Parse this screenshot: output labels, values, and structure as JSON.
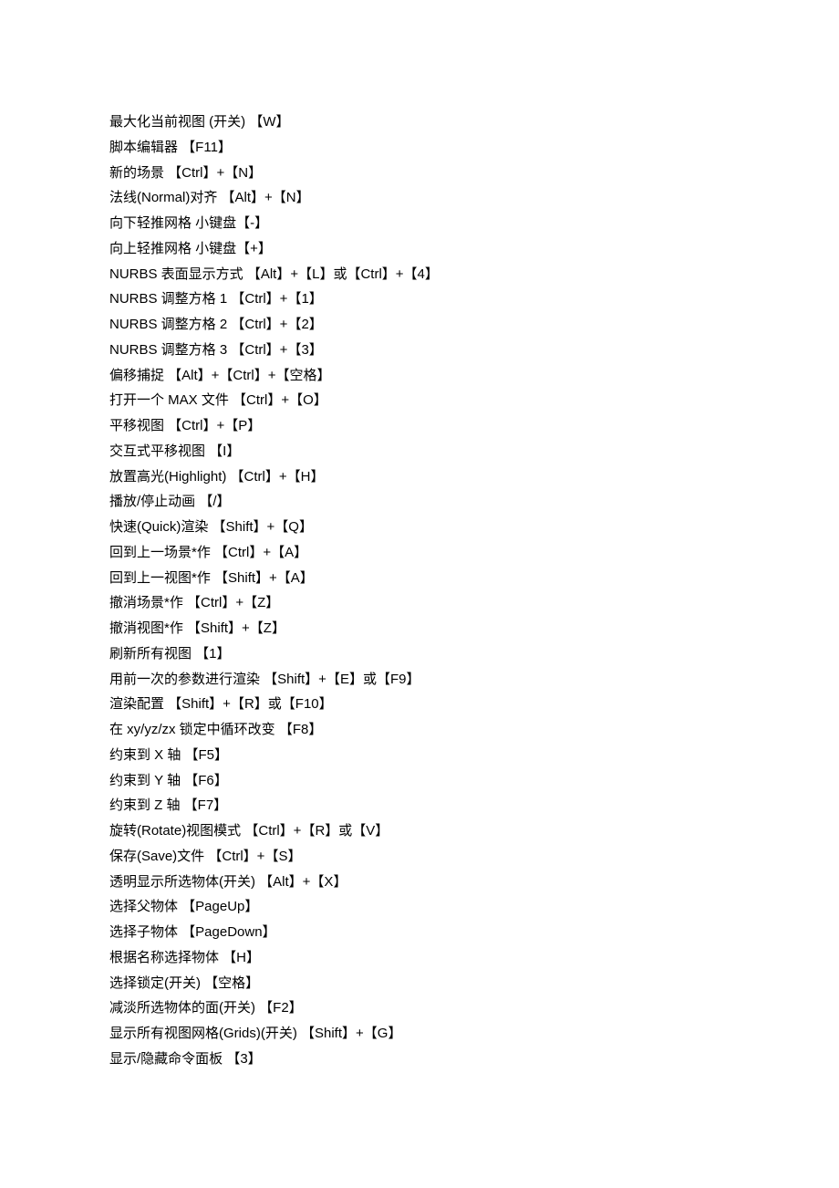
{
  "shortcuts": [
    {
      "desc": "最大化当前视图 (开关) ",
      "key": "【W】"
    },
    {
      "desc": "脚本编辑器 ",
      "key": "【F11】"
    },
    {
      "desc": "新的场景 ",
      "key": "【Ctrl】+【N】"
    },
    {
      "desc": "法线(Normal)对齐 ",
      "key": "【Alt】+【N】"
    },
    {
      "desc": "向下轻推网格 ",
      "key": "小键盘【-】"
    },
    {
      "desc": "向上轻推网格 ",
      "key": "小键盘【+】"
    },
    {
      "desc": "NURBS 表面显示方式 ",
      "key": "【Alt】+【L】或【Ctrl】+【4】"
    },
    {
      "desc": "NURBS 调整方格 1 ",
      "key": "【Ctrl】+【1】"
    },
    {
      "desc": "NURBS 调整方格 2 ",
      "key": "【Ctrl】+【2】"
    },
    {
      "desc": "NURBS 调整方格 3 ",
      "key": "【Ctrl】+【3】"
    },
    {
      "desc": "偏移捕捉 ",
      "key": "【Alt】+【Ctrl】+【空格】"
    },
    {
      "desc": "打开一个 MAX 文件 ",
      "key": "【Ctrl】+【O】"
    },
    {
      "desc": "平移视图 ",
      "key": "【Ctrl】+【P】"
    },
    {
      "desc": "交互式平移视图 ",
      "key": "【I】"
    },
    {
      "desc": "放置高光(Highlight) ",
      "key": "【Ctrl】+【H】"
    },
    {
      "desc": "播放/停止动画 ",
      "key": "【/】"
    },
    {
      "desc": "快速(Quick)渲染 ",
      "key": "【Shift】+【Q】"
    },
    {
      "desc": "回到上一场景*作 ",
      "key": "【Ctrl】+【A】"
    },
    {
      "desc": "回到上一视图*作 ",
      "key": "【Shift】+【A】"
    },
    {
      "desc": "撤消场景*作 ",
      "key": "【Ctrl】+【Z】"
    },
    {
      "desc": "撤消视图*作 ",
      "key": "【Shift】+【Z】"
    },
    {
      "desc": "刷新所有视图 ",
      "key": "【1】"
    },
    {
      "desc": "用前一次的参数进行渲染 ",
      "key": "【Shift】+【E】或【F9】"
    },
    {
      "desc": "渲染配置 ",
      "key": "【Shift】+【R】或【F10】"
    },
    {
      "desc": "在 xy/yz/zx 锁定中循环改变 ",
      "key": "【F8】"
    },
    {
      "desc": "约束到 X 轴 ",
      "key": "【F5】"
    },
    {
      "desc": "约束到 Y 轴 ",
      "key": "【F6】"
    },
    {
      "desc": "约束到 Z 轴 ",
      "key": "【F7】"
    },
    {
      "desc": "旋转(Rotate)视图模式 ",
      "key": "【Ctrl】+【R】或【V】"
    },
    {
      "desc": "保存(Save)文件 ",
      "key": "【Ctrl】+【S】"
    },
    {
      "desc": "透明显示所选物体(开关) ",
      "key": "【Alt】+【X】"
    },
    {
      "desc": "选择父物体 ",
      "key": "【PageUp】"
    },
    {
      "desc": "选择子物体 ",
      "key": "【PageDown】"
    },
    {
      "desc": "根据名称选择物体 ",
      "key": "【H】"
    },
    {
      "desc": "选择锁定(开关) ",
      "key": "【空格】"
    },
    {
      "desc": "减淡所选物体的面(开关) ",
      "key": "【F2】"
    },
    {
      "desc": "显示所有视图网格(Grids)(开关) ",
      "key": "【Shift】+【G】"
    },
    {
      "desc": "显示/隐藏命令面板 ",
      "key": "【3】"
    }
  ]
}
